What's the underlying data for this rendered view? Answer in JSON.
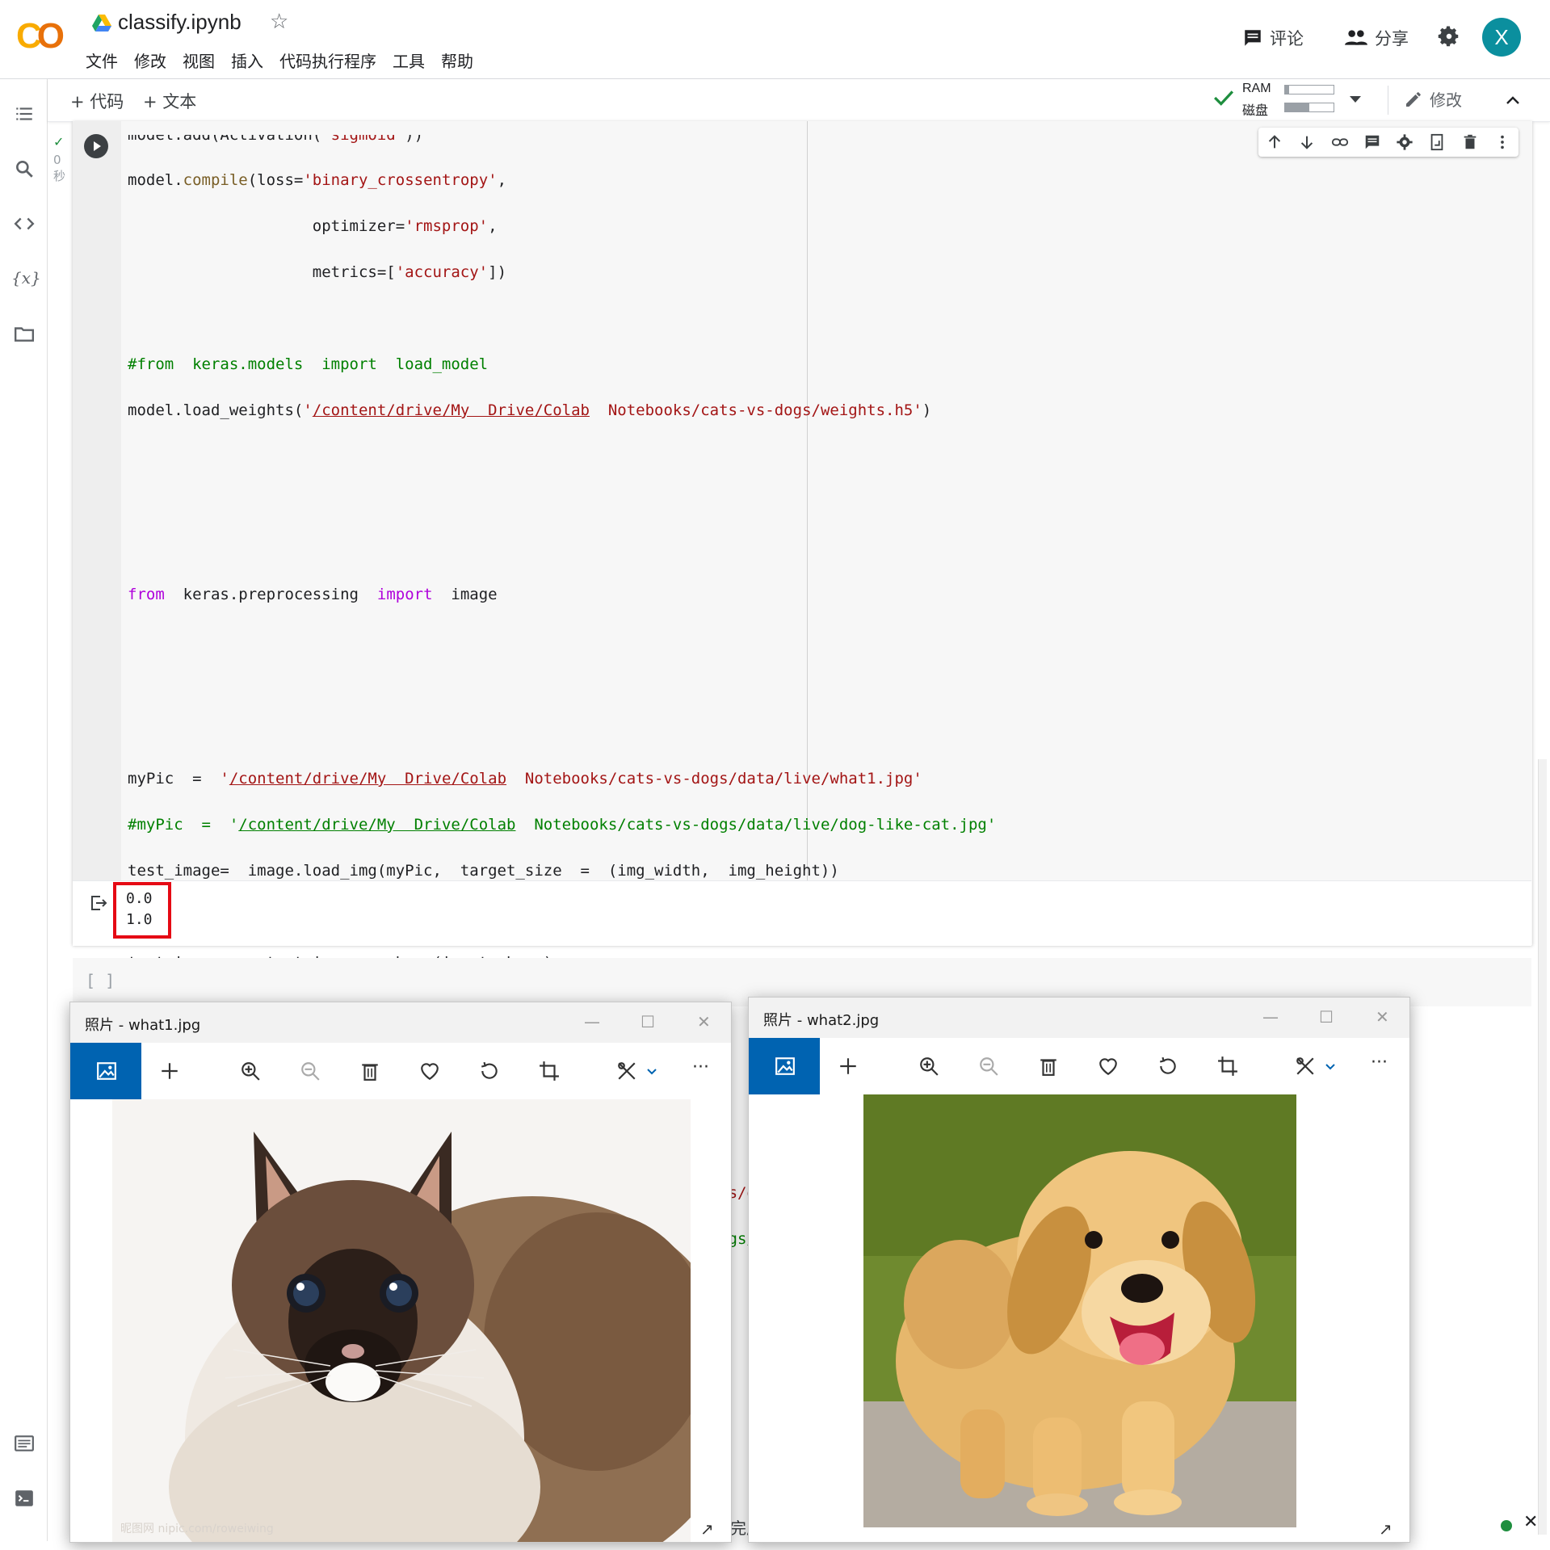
{
  "header": {
    "title": "classify.ipynb",
    "menu": [
      "文件",
      "修改",
      "视图",
      "插入",
      "代码执行程序",
      "工具",
      "帮助"
    ],
    "comment_label": "评论",
    "share_label": "分享",
    "avatar_letter": "X"
  },
  "toolbar": {
    "add_code": "+ 代码",
    "add_text": "+ 文本",
    "ram_label": "RAM",
    "disk_label": "磁盘",
    "ram_usage": 0.08,
    "disk_usage": 0.5,
    "edit_label": "修改"
  },
  "cell": {
    "exec_check": "✓",
    "exec_time": "0\n秒",
    "output_lines": [
      "0.0",
      "1.0"
    ],
    "empty_cell": "[ ]"
  },
  "windows": [
    {
      "title": "照片 - what1.jpg",
      "watermark": "昵图网 nipic.com/roweiwing"
    },
    {
      "title": "照片 - what2.jpg"
    }
  ],
  "bottom": {
    "partial_text": "完成"
  },
  "colors": {
    "accent": "#0063b1",
    "avatar": "#0b8f9e",
    "highlight_box": "#e50914",
    "ok_green": "#1e8e3e"
  }
}
